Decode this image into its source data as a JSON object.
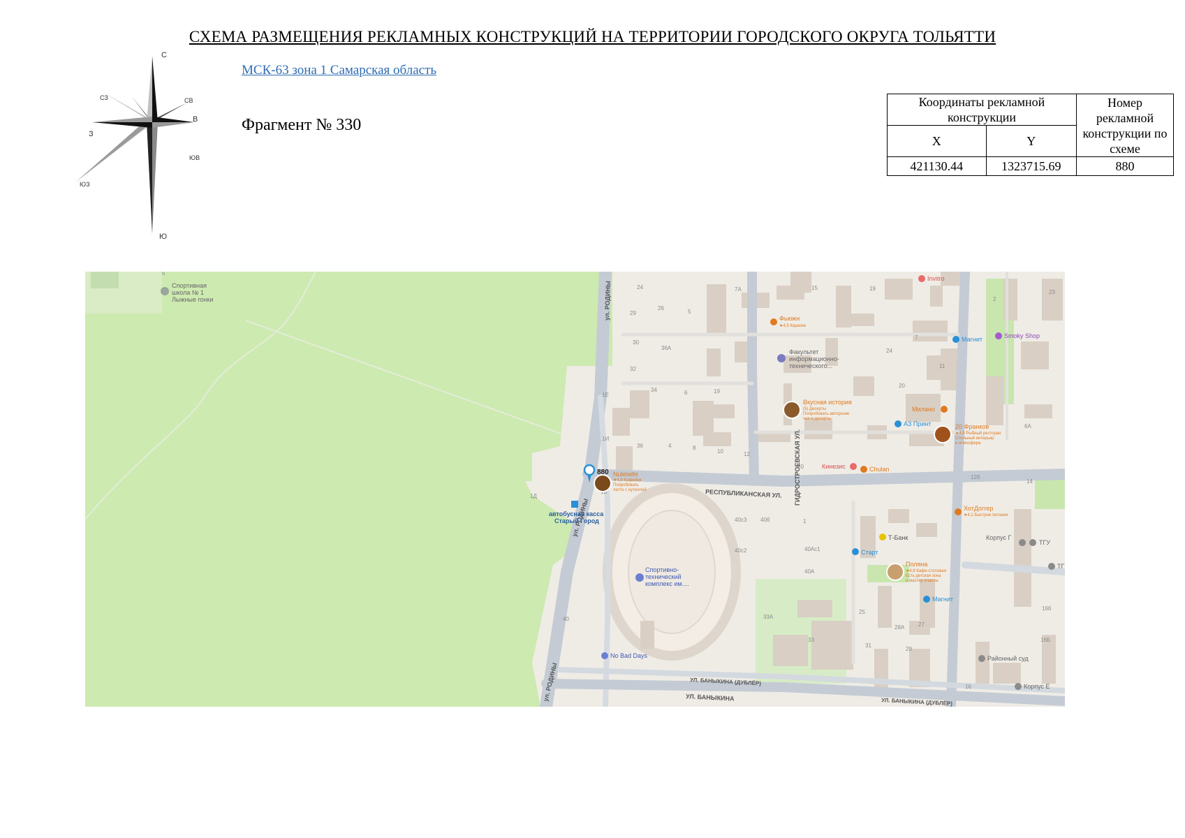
{
  "header": {
    "title": "СХЕМА РАЗМЕЩЕНИЯ РЕКЛАМНЫХ КОНСТРУКЦИЙ НА ТЕРРИТОРИИ ГОРОДСКОГО ОКРУГА ТОЛЬЯТТИ",
    "crs_link": "МСК-63 зона 1 Самарская область",
    "fragment": "Фрагмент № 330"
  },
  "compass": {
    "n": "С",
    "s": "Ю",
    "e": "В",
    "w": "З",
    "ne": "СВ",
    "nw": "СЗ",
    "se": "ЮВ",
    "sw": "ЮЗ"
  },
  "table": {
    "coords_header": "Координаты рекламной конструкции",
    "x_header": "X",
    "y_header": "Y",
    "number_header": "Номер рекламной конструкции по схеме",
    "x_value": "421130.44",
    "y_value": "1323715.69",
    "number_value": "880"
  },
  "map": {
    "marker_label": "880",
    "colors": {
      "forest": "#cdeab0",
      "urban": "#efece6",
      "road": "#c4cbd4",
      "building": "#d8cfc4",
      "poi_orange": "#e07a1f",
      "transit_blue": "#2a8fd6",
      "marker": "#2a8fd6"
    },
    "streets": {
      "rodiny_top": "ул. РОДИНЫ",
      "rodiny_mid": "ул. РОДИНЫ",
      "rodiny_bottom": "ул. РОДИНЫ",
      "respublikanskaya": "РЕСПУБЛИКАНСКАЯ УЛ.",
      "gidrostroevskaya": "ГИДРОСТРОЕВСКАЯ УЛ.",
      "banykina_dubler": "УЛ. БАНЫКИНА (ДУБЛЁР)",
      "banykina": "УЛ. БАНЫКИНА",
      "banykina_dubler_right": "УЛ. БАНЫКИНА (ДУБЛЁР)"
    },
    "pois": {
      "sport_school_1": "Спортивная",
      "sport_school_2": "школа № 1",
      "sport_school_3": "Лыжные гонки",
      "invitro": "Invitro",
      "fyuzhn": "Фьюжн",
      "fyuzhn_sub": "★4,5 Караоке",
      "faculty_1": "Факультет",
      "faculty_2": "информационно-",
      "faculty_3": "технического...",
      "magnit_top": "Магнит",
      "smoky_shop": "Smoky Shop",
      "vkusnaya": "Вкусная история",
      "vkusnaya_sub1": "(5) Десерты",
      "vkusnaya_sub2": "Попробовать авторские",
      "vkusnaya_sub3": "чаи и десерты",
      "milano": "Милано",
      "az_print": "АЗ Принт",
      "franks": "20 Франков",
      "franks_sub1": "★4,9 Рыбный ресторан",
      "franks_sub2": "Стильный интерьер",
      "franks_sub3": "и атмосфера",
      "kinezis": "Кинезис",
      "chulan": "Chulan",
      "nutelatte": "Nutelatte",
      "nutelatte_sub1": "★4,9 Кофейня",
      "nutelatte_sub2": "Попробовать",
      "nutelatte_sub3": "латте с нутеллой",
      "bus_kassa_1": "автобусная касса",
      "bus_kassa_2": "Старый Город",
      "hotdogger": "ХотДоггер",
      "hotdogger_sub": "★4,1 Быстрое питание",
      "tbank": "Т-Банк",
      "start": "Старт",
      "korpus_g": "Корпус Г",
      "tgu": "ТГУ",
      "tg": "ТГ",
      "polyana": "Поляна",
      "polyana_sub1": "★4,8 Кафе-столовая",
      "polyana_sub2": "Есть детская зона",
      "polyana_sub3": "и мастер-классы",
      "sport_complex_1": "Спортивно-",
      "sport_complex_2": "технический",
      "sport_complex_3": "комплекс им....",
      "magnit_bottom": "Магнит",
      "no_bad_days": "No Bad Days",
      "district_court": "Районный суд",
      "korpus_e": "Корпус Е"
    },
    "house_numbers": [
      "5",
      "24",
      "29",
      "26",
      "5",
      "7А",
      "15",
      "19",
      "30",
      "36А",
      "32",
      "34",
      "6",
      "19",
      "1Е",
      "1И",
      "36",
      "4",
      "8",
      "10",
      "12",
      "20",
      "12б",
      "14",
      "1Б",
      "1Д",
      "40с3",
      "40б",
      "1",
      "40Ас1",
      "40с2",
      "40А",
      "25",
      "27",
      "33А",
      "33",
      "31",
      "28А",
      "29",
      "40",
      "16",
      "16Б",
      "16б",
      "6А",
      "23",
      "11",
      "20",
      "7",
      "2",
      "24"
    ]
  }
}
